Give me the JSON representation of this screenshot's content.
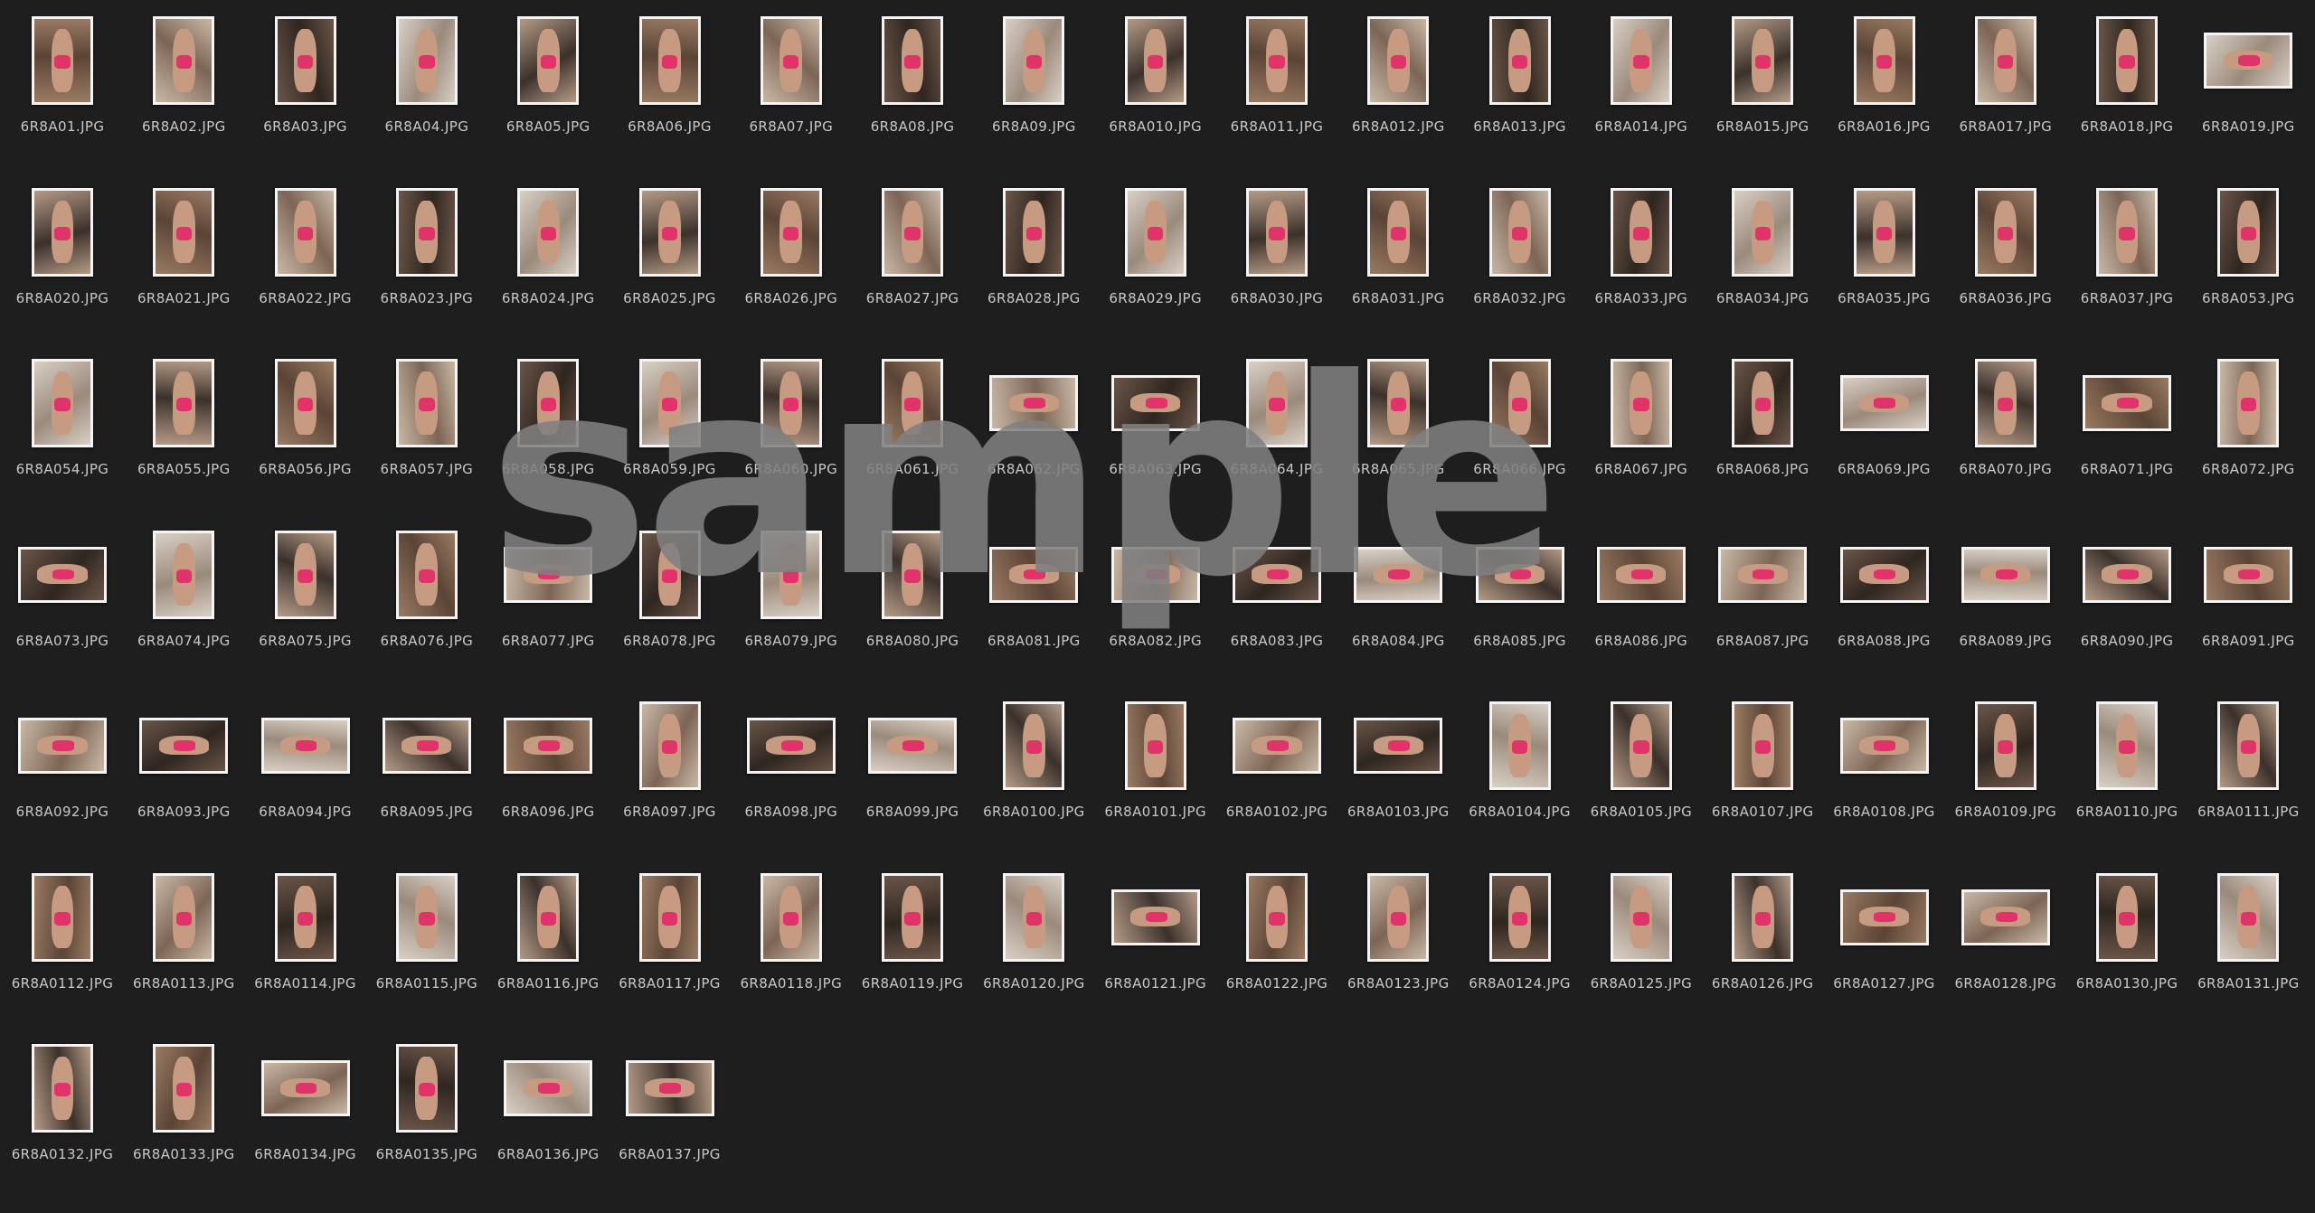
{
  "watermark_text": "sample",
  "colors": {
    "background": "#1e1e1e",
    "label": "#c8c8c8",
    "thumb_border": "#f4f4f4",
    "watermark": "#808080",
    "accent_pink": "#e0336a"
  },
  "files": [
    {
      "name": "6R8A01.JPG",
      "orientation": "portrait"
    },
    {
      "name": "6R8A02.JPG",
      "orientation": "portrait"
    },
    {
      "name": "6R8A03.JPG",
      "orientation": "portrait"
    },
    {
      "name": "6R8A04.JPG",
      "orientation": "portrait"
    },
    {
      "name": "6R8A05.JPG",
      "orientation": "portrait"
    },
    {
      "name": "6R8A06.JPG",
      "orientation": "portrait"
    },
    {
      "name": "6R8A07.JPG",
      "orientation": "portrait"
    },
    {
      "name": "6R8A08.JPG",
      "orientation": "portrait"
    },
    {
      "name": "6R8A09.JPG",
      "orientation": "portrait"
    },
    {
      "name": "6R8A010.JPG",
      "orientation": "portrait"
    },
    {
      "name": "6R8A011.JPG",
      "orientation": "portrait"
    },
    {
      "name": "6R8A012.JPG",
      "orientation": "portrait"
    },
    {
      "name": "6R8A013.JPG",
      "orientation": "portrait"
    },
    {
      "name": "6R8A014.JPG",
      "orientation": "portrait"
    },
    {
      "name": "6R8A015.JPG",
      "orientation": "portrait"
    },
    {
      "name": "6R8A016.JPG",
      "orientation": "portrait"
    },
    {
      "name": "6R8A017.JPG",
      "orientation": "portrait"
    },
    {
      "name": "6R8A018.JPG",
      "orientation": "portrait"
    },
    {
      "name": "6R8A019.JPG",
      "orientation": "landscape"
    },
    {
      "name": "6R8A020.JPG",
      "orientation": "portrait"
    },
    {
      "name": "6R8A021.JPG",
      "orientation": "portrait"
    },
    {
      "name": "6R8A022.JPG",
      "orientation": "portrait"
    },
    {
      "name": "6R8A023.JPG",
      "orientation": "portrait"
    },
    {
      "name": "6R8A024.JPG",
      "orientation": "portrait"
    },
    {
      "name": "6R8A025.JPG",
      "orientation": "portrait"
    },
    {
      "name": "6R8A026.JPG",
      "orientation": "portrait"
    },
    {
      "name": "6R8A027.JPG",
      "orientation": "portrait"
    },
    {
      "name": "6R8A028.JPG",
      "orientation": "portrait"
    },
    {
      "name": "6R8A029.JPG",
      "orientation": "portrait"
    },
    {
      "name": "6R8A030.JPG",
      "orientation": "portrait"
    },
    {
      "name": "6R8A031.JPG",
      "orientation": "portrait"
    },
    {
      "name": "6R8A032.JPG",
      "orientation": "portrait"
    },
    {
      "name": "6R8A033.JPG",
      "orientation": "portrait"
    },
    {
      "name": "6R8A034.JPG",
      "orientation": "portrait"
    },
    {
      "name": "6R8A035.JPG",
      "orientation": "portrait"
    },
    {
      "name": "6R8A036.JPG",
      "orientation": "portrait"
    },
    {
      "name": "6R8A037.JPG",
      "orientation": "portrait"
    },
    {
      "name": "6R8A053.JPG",
      "orientation": "portrait"
    },
    {
      "name": "6R8A054.JPG",
      "orientation": "portrait"
    },
    {
      "name": "6R8A055.JPG",
      "orientation": "portrait"
    },
    {
      "name": "6R8A056.JPG",
      "orientation": "portrait"
    },
    {
      "name": "6R8A057.JPG",
      "orientation": "portrait"
    },
    {
      "name": "6R8A058.JPG",
      "orientation": "portrait"
    },
    {
      "name": "6R8A059.JPG",
      "orientation": "portrait"
    },
    {
      "name": "6R8A060.JPG",
      "orientation": "portrait"
    },
    {
      "name": "6R8A061.JPG",
      "orientation": "portrait"
    },
    {
      "name": "6R8A062.JPG",
      "orientation": "landscape"
    },
    {
      "name": "6R8A063.JPG",
      "orientation": "landscape"
    },
    {
      "name": "6R8A064.JPG",
      "orientation": "portrait"
    },
    {
      "name": "6R8A065.JPG",
      "orientation": "portrait"
    },
    {
      "name": "6R8A066.JPG",
      "orientation": "portrait"
    },
    {
      "name": "6R8A067.JPG",
      "orientation": "portrait"
    },
    {
      "name": "6R8A068.JPG",
      "orientation": "portrait"
    },
    {
      "name": "6R8A069.JPG",
      "orientation": "landscape"
    },
    {
      "name": "6R8A070.JPG",
      "orientation": "portrait"
    },
    {
      "name": "6R8A071.JPG",
      "orientation": "landscape"
    },
    {
      "name": "6R8A072.JPG",
      "orientation": "portrait"
    },
    {
      "name": "6R8A073.JPG",
      "orientation": "landscape"
    },
    {
      "name": "6R8A074.JPG",
      "orientation": "portrait"
    },
    {
      "name": "6R8A075.JPG",
      "orientation": "portrait"
    },
    {
      "name": "6R8A076.JPG",
      "orientation": "portrait"
    },
    {
      "name": "6R8A077.JPG",
      "orientation": "landscape"
    },
    {
      "name": "6R8A078.JPG",
      "orientation": "portrait"
    },
    {
      "name": "6R8A079.JPG",
      "orientation": "portrait"
    },
    {
      "name": "6R8A080.JPG",
      "orientation": "portrait"
    },
    {
      "name": "6R8A081.JPG",
      "orientation": "landscape"
    },
    {
      "name": "6R8A082.JPG",
      "orientation": "landscape"
    },
    {
      "name": "6R8A083.JPG",
      "orientation": "landscape"
    },
    {
      "name": "6R8A084.JPG",
      "orientation": "landscape"
    },
    {
      "name": "6R8A085.JPG",
      "orientation": "landscape"
    },
    {
      "name": "6R8A086.JPG",
      "orientation": "landscape"
    },
    {
      "name": "6R8A087.JPG",
      "orientation": "landscape"
    },
    {
      "name": "6R8A088.JPG",
      "orientation": "landscape"
    },
    {
      "name": "6R8A089.JPG",
      "orientation": "landscape"
    },
    {
      "name": "6R8A090.JPG",
      "orientation": "landscape"
    },
    {
      "name": "6R8A091.JPG",
      "orientation": "landscape"
    },
    {
      "name": "6R8A092.JPG",
      "orientation": "landscape"
    },
    {
      "name": "6R8A093.JPG",
      "orientation": "landscape"
    },
    {
      "name": "6R8A094.JPG",
      "orientation": "landscape"
    },
    {
      "name": "6R8A095.JPG",
      "orientation": "landscape"
    },
    {
      "name": "6R8A096.JPG",
      "orientation": "landscape"
    },
    {
      "name": "6R8A097.JPG",
      "orientation": "portrait"
    },
    {
      "name": "6R8A098.JPG",
      "orientation": "landscape"
    },
    {
      "name": "6R8A099.JPG",
      "orientation": "landscape"
    },
    {
      "name": "6R8A0100.JPG",
      "orientation": "portrait"
    },
    {
      "name": "6R8A0101.JPG",
      "orientation": "portrait"
    },
    {
      "name": "6R8A0102.JPG",
      "orientation": "landscape"
    },
    {
      "name": "6R8A0103.JPG",
      "orientation": "landscape"
    },
    {
      "name": "6R8A0104.JPG",
      "orientation": "portrait"
    },
    {
      "name": "6R8A0105.JPG",
      "orientation": "portrait"
    },
    {
      "name": "6R8A0107.JPG",
      "orientation": "portrait"
    },
    {
      "name": "6R8A0108.JPG",
      "orientation": "landscape"
    },
    {
      "name": "6R8A0109.JPG",
      "orientation": "portrait"
    },
    {
      "name": "6R8A0110.JPG",
      "orientation": "portrait"
    },
    {
      "name": "6R8A0111.JPG",
      "orientation": "portrait"
    },
    {
      "name": "6R8A0112.JPG",
      "orientation": "portrait"
    },
    {
      "name": "6R8A0113.JPG",
      "orientation": "portrait"
    },
    {
      "name": "6R8A0114.JPG",
      "orientation": "portrait"
    },
    {
      "name": "6R8A0115.JPG",
      "orientation": "portrait"
    },
    {
      "name": "6R8A0116.JPG",
      "orientation": "portrait"
    },
    {
      "name": "6R8A0117.JPG",
      "orientation": "portrait"
    },
    {
      "name": "6R8A0118.JPG",
      "orientation": "portrait"
    },
    {
      "name": "6R8A0119.JPG",
      "orientation": "portrait"
    },
    {
      "name": "6R8A0120.JPG",
      "orientation": "portrait"
    },
    {
      "name": "6R8A0121.JPG",
      "orientation": "landscape"
    },
    {
      "name": "6R8A0122.JPG",
      "orientation": "portrait"
    },
    {
      "name": "6R8A0123.JPG",
      "orientation": "portrait"
    },
    {
      "name": "6R8A0124.JPG",
      "orientation": "portrait"
    },
    {
      "name": "6R8A0125.JPG",
      "orientation": "portrait"
    },
    {
      "name": "6R8A0126.JPG",
      "orientation": "portrait"
    },
    {
      "name": "6R8A0127.JPG",
      "orientation": "landscape"
    },
    {
      "name": "6R8A0128.JPG",
      "orientation": "landscape"
    },
    {
      "name": "6R8A0130.JPG",
      "orientation": "portrait"
    },
    {
      "name": "6R8A0131.JPG",
      "orientation": "portrait"
    },
    {
      "name": "6R8A0132.JPG",
      "orientation": "portrait"
    },
    {
      "name": "6R8A0133.JPG",
      "orientation": "portrait"
    },
    {
      "name": "6R8A0134.JPG",
      "orientation": "landscape"
    },
    {
      "name": "6R8A0135.JPG",
      "orientation": "portrait"
    },
    {
      "name": "6R8A0136.JPG",
      "orientation": "landscape"
    },
    {
      "name": "6R8A0137.JPG",
      "orientation": "landscape"
    }
  ]
}
